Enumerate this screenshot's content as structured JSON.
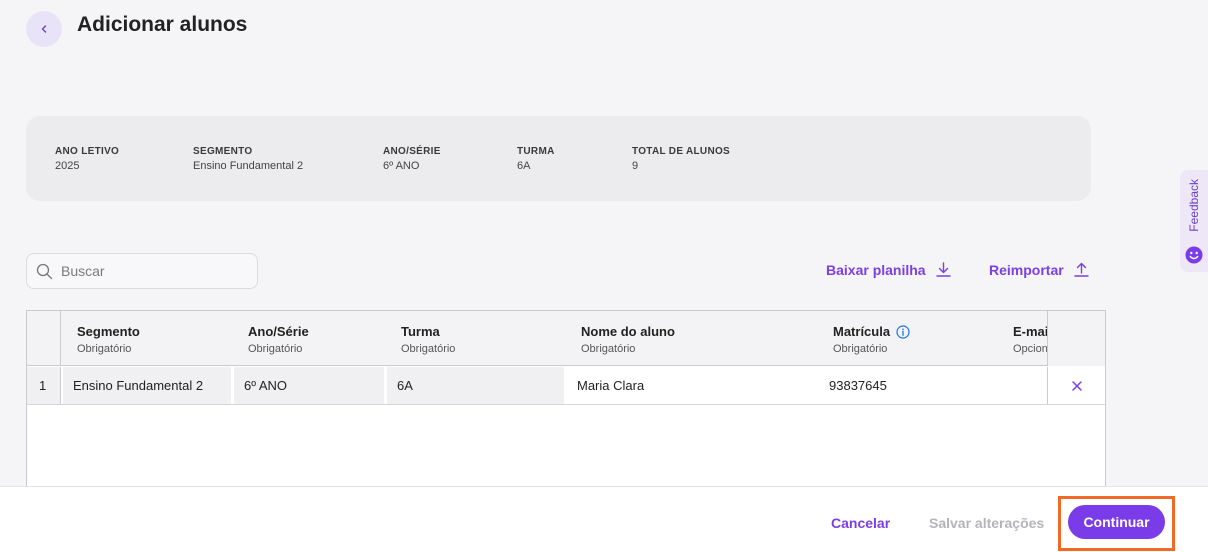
{
  "header": {
    "title": "Adicionar alunos",
    "back_icon": "chevron-left-icon"
  },
  "summary": [
    {
      "label": "ANO LETIVO",
      "value": "2025"
    },
    {
      "label": "SEGMENTO",
      "value": "Ensino Fundamental 2"
    },
    {
      "label": "ANO/SÉRIE",
      "value": "6º ANO"
    },
    {
      "label": "TURMA",
      "value": "6A"
    },
    {
      "label": "TOTAL DE ALUNOS",
      "value": "9"
    }
  ],
  "search": {
    "placeholder": "Buscar",
    "value": ""
  },
  "actions": {
    "download_label": "Baixar planilha",
    "reimport_label": "Reimportar"
  },
  "table": {
    "columns": [
      {
        "title": "Segmento",
        "subtitle": "Obrigatório"
      },
      {
        "title": "Ano/Série",
        "subtitle": "Obrigatório"
      },
      {
        "title": "Turma",
        "subtitle": "Obrigatório"
      },
      {
        "title": "Nome do aluno",
        "subtitle": "Obrigatório"
      },
      {
        "title": "Matrícula",
        "subtitle": "Obrigatório"
      },
      {
        "title": "E-mai",
        "subtitle": "Opcion"
      }
    ],
    "rows": [
      {
        "index": "1",
        "segmento": "Ensino Fundamental 2",
        "ano_serie": "6º ANO",
        "turma": "6A",
        "nome": "Maria Clara",
        "matricula": "93837645",
        "email": ""
      }
    ]
  },
  "feedback": {
    "label": "Feedback"
  },
  "footer": {
    "cancel_label": "Cancelar",
    "save_label": "Salvar alterações",
    "continue_label": "Continuar"
  },
  "colors": {
    "accent": "#7a3ce8",
    "highlight": "#f06a25",
    "info": "#1a73e8"
  }
}
